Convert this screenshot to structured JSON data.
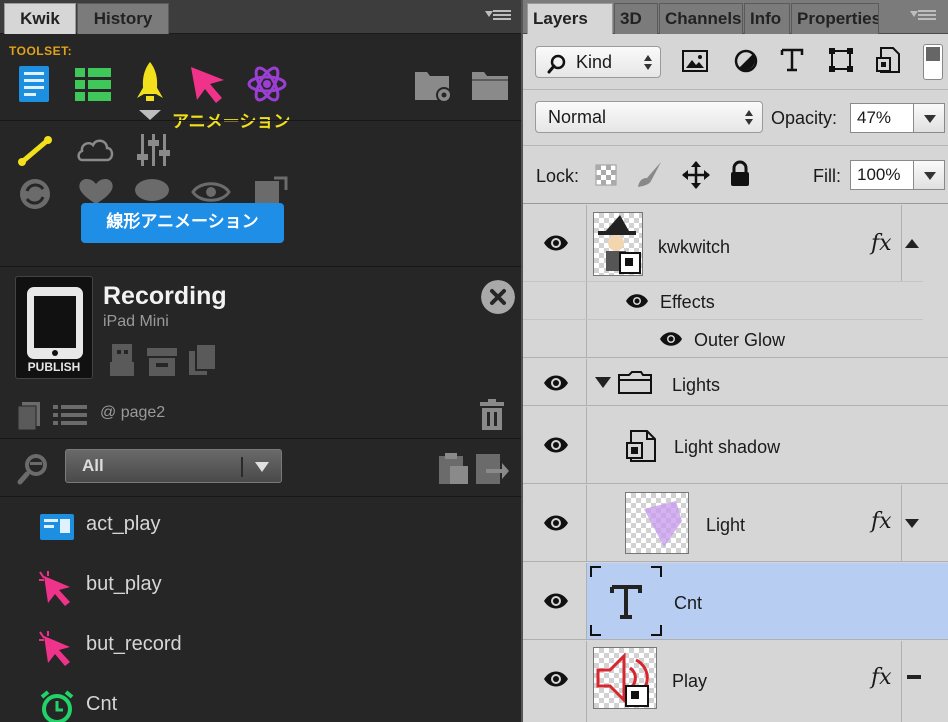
{
  "kwik": {
    "tabs": [
      {
        "label": "Kwik"
      },
      {
        "label": "History"
      }
    ],
    "toolset_label": "TOOLSET:",
    "animation_label": "アニメーション",
    "tooltip": "線形アニメーション",
    "recording": {
      "title": "Recording",
      "device": "iPad Mini",
      "publish_label": "PUBLISH"
    },
    "page_label": "@ page2",
    "filter": {
      "value": "All"
    },
    "list": [
      {
        "label": "act_play",
        "icon": "action-icon"
      },
      {
        "label": "but_play",
        "icon": "button-icon"
      },
      {
        "label": "but_record",
        "icon": "button-icon"
      },
      {
        "label": "Cnt",
        "icon": "timer-icon"
      }
    ],
    "colors": {
      "accent": "#1e8ee6",
      "toolset": "#e0a21a",
      "highlight": "#f2e01c"
    }
  },
  "layers": {
    "tabs": [
      {
        "label": "Layers"
      },
      {
        "label": "3D"
      },
      {
        "label": "Channels"
      },
      {
        "label": "Info"
      },
      {
        "label": "Properties"
      }
    ],
    "kind_filter": "Kind",
    "blend_mode": "Normal",
    "opacity_label": "Opacity:",
    "opacity": "47%",
    "lock_label": "Lock:",
    "fill_label": "Fill:",
    "fill": "100%",
    "items": [
      {
        "name": "kwkwitch",
        "fx": "fx",
        "effects_label": "Effects",
        "effect": "Outer Glow"
      },
      {
        "name": "Lights"
      },
      {
        "name": "Light shadow"
      },
      {
        "name": "Light",
        "fx": "fx"
      },
      {
        "name": "Cnt",
        "selected": true
      },
      {
        "name": "Play",
        "fx": "fx"
      }
    ],
    "colors": {
      "selected_row": "#b7cdf2"
    }
  }
}
